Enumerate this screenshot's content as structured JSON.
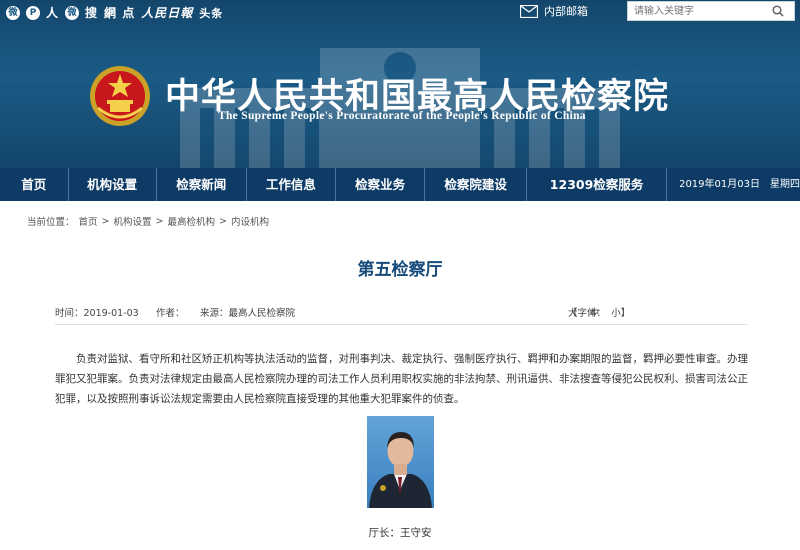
{
  "share_bar": {
    "icons": [
      "weibo-icon",
      "people-icon",
      "wechat-icon",
      "sohu-icon",
      "netease-icon",
      "people-daily-icon"
    ],
    "labels": [
      "人",
      "搜",
      "網 点",
      "人民日報"
    ],
    "toutiao": "头条"
  },
  "mail": {
    "label": "内部邮箱"
  },
  "search": {
    "placeholder": "请输入关键字"
  },
  "site": {
    "title_cn": "中华人民共和国最高人民检察院",
    "title_en": "The Supreme People's Procuratorate of the People's Republic of China"
  },
  "nav": {
    "items": [
      "首页",
      "机构设置",
      "检察新闻",
      "工作信息",
      "检察业务",
      "检察院建设",
      "12309检察服务"
    ],
    "date": "2019年01月03日　星期四"
  },
  "breadcrumb": {
    "prefix": "当前位置：",
    "items": [
      "首页",
      "机构设置",
      "最高检机构",
      "内设机构"
    ],
    "separator": ">"
  },
  "article": {
    "title": "第五检察厅",
    "time_label": "时间：2019-01-03",
    "author_label": "作者：",
    "source_label": "来源：最高人民检察院",
    "font_size": {
      "prefix": "【字体：",
      "large": "大",
      "medium": "中",
      "small": "小",
      "suffix": "】"
    },
    "body": "负责对监狱、看守所和社区矫正机构等执法活动的监督，对刑事判决、裁定执行、强制医疗执行、羁押和办案期限的监督，羁押必要性审查。办理罪犯又犯罪案。负责对法律规定由最高人民检察院办理的司法工作人员利用职权实施的非法拘禁、刑讯逼供、非法搜查等侵犯公民权利、损害司法公正犯罪，以及按照刑事诉讼法规定需要由人民检察院直接受理的其他重大犯罪案件的侦查。",
    "caption": "厅长：王守安"
  },
  "colors": {
    "banner": "#1b5b86",
    "nav": "#0d3b66",
    "title": "#164a7a"
  }
}
